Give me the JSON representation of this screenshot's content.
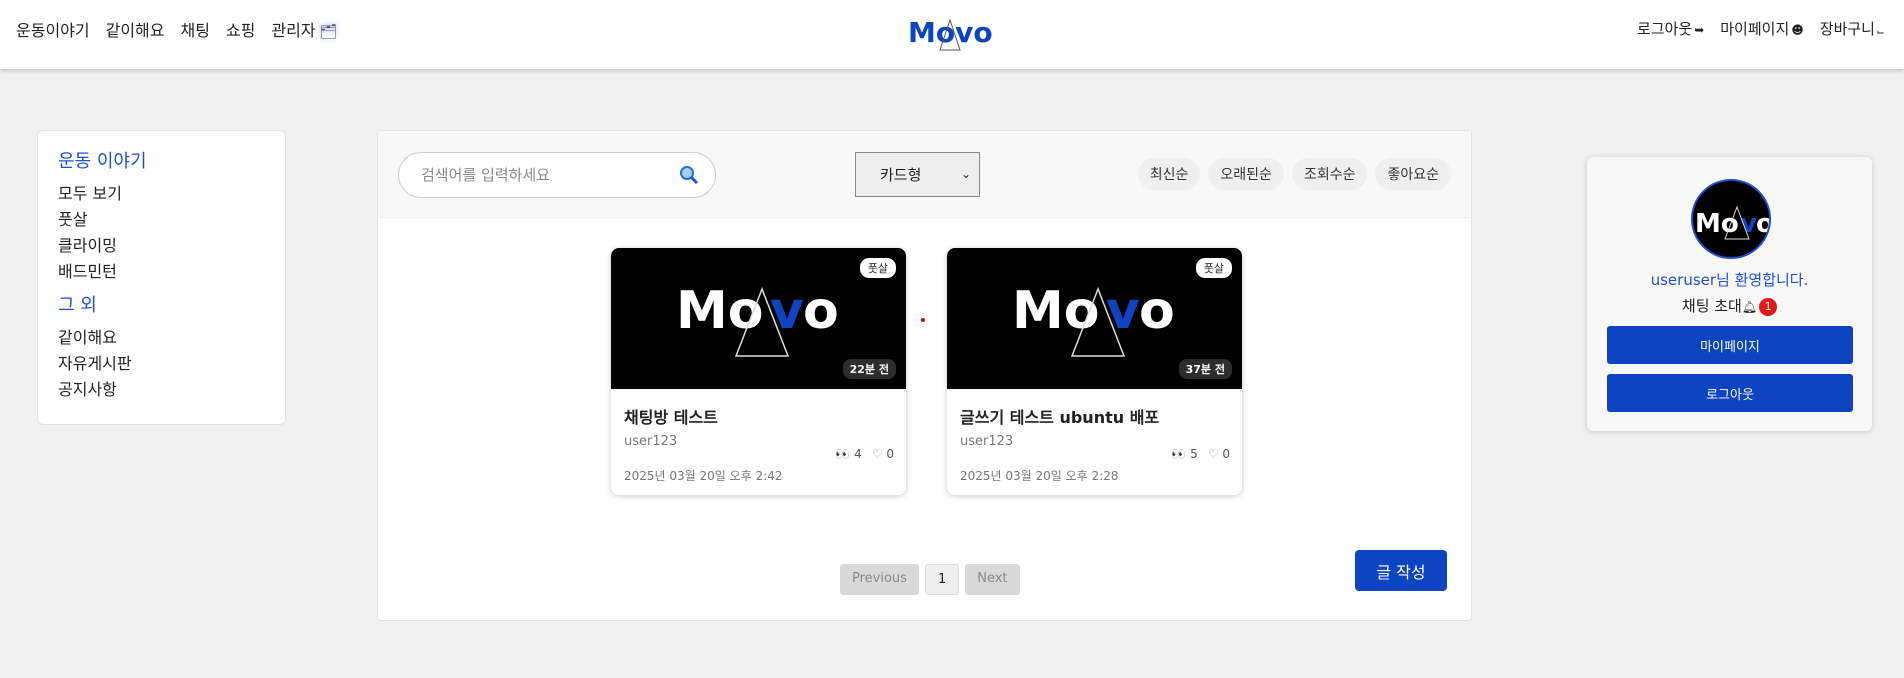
{
  "header": {
    "nav_left": [
      "운동이야기",
      "같이해요",
      "채팅",
      "쇼핑",
      "관리자"
    ],
    "admin_icon": "user-badge-icon",
    "logo_text": "Movo",
    "nav_right": {
      "logout": "로그아웃",
      "mypage": "마이페이지",
      "cart": "장바구니"
    }
  },
  "sidebar": {
    "section1": "운동 이야기",
    "items1": [
      "모두 보기",
      "풋살",
      "클라이밍",
      "배드민턴"
    ],
    "section2": "그 외",
    "items2": [
      "같이해요",
      "자유게시판",
      "공지사항"
    ]
  },
  "toolbar": {
    "search_placeholder": "검색어를 입력하세요",
    "view_selected": "카드형",
    "sort": [
      "최신순",
      "오래된순",
      "조회수순",
      "좋아요순"
    ]
  },
  "posts": [
    {
      "tag": "풋살",
      "time_ago": "22분 전",
      "title": "채팅방 테스트",
      "author": "user123",
      "views": "4",
      "likes": "0",
      "date": "2025년 03월 20일 오후 2:42"
    },
    {
      "tag": "풋살",
      "time_ago": "37분 전",
      "title": "글쓰기 테스트 ubuntu 배포",
      "author": "user123",
      "views": "5",
      "likes": "0",
      "date": "2025년 03월 20일 오후 2:28"
    }
  ],
  "pagination": {
    "previous": "Previous",
    "page": "1",
    "next": "Next"
  },
  "write_button": "글 작성",
  "profile": {
    "welcome": "useruser님 환영합니다.",
    "chat_invite": "채팅 초대",
    "notification_count": "1",
    "mypage_button": "마이페이지",
    "logout_button": "로그아웃"
  },
  "colors": {
    "brand_blue": "#0d44c2",
    "link_blue": "#1f4fd1",
    "badge_red": "#e21818"
  }
}
